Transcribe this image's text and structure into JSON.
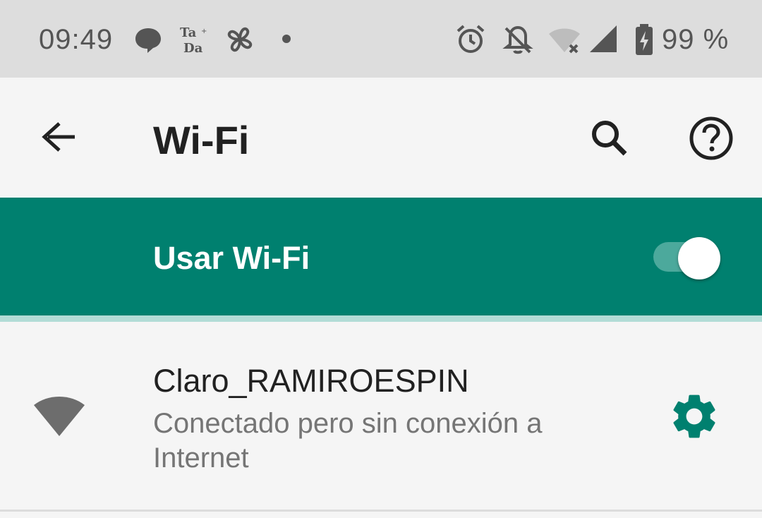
{
  "status_bar": {
    "time": "09:49",
    "battery_percent": "99 %",
    "icons": [
      "messages-icon",
      "tada-app-icon",
      "pinwheel-app-icon",
      "dot-indicator-icon",
      "alarm-icon",
      "notifications-off-icon",
      "wifi-no-internet-icon",
      "cell-signal-icon",
      "battery-charging-icon"
    ],
    "icon_color": "#555555"
  },
  "app_bar": {
    "title": "Wi-Fi",
    "back_icon": "arrow-back-icon",
    "search_icon": "search-icon",
    "help_icon": "help-circle-icon"
  },
  "master_switch": {
    "label": "Usar Wi-Fi",
    "state": "on",
    "background_color": "#00806f"
  },
  "networks": [
    {
      "name": "Claro_RAMIROESPIN",
      "status": "Conectado pero sin conexión a Internet",
      "signal_icon": "wifi-signal-icon",
      "settings_icon": "gear-icon",
      "accent_color": "#00806f"
    }
  ]
}
